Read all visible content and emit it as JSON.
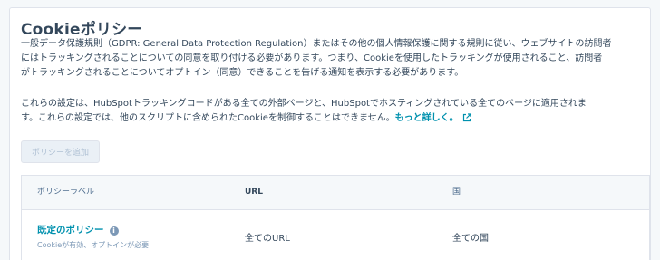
{
  "section": {
    "title": "Cookieポリシー",
    "paragraph1_lines": [
      "一般データ保護規則（GDPR: General Data Protection Regulation）またはその他の個人情報保護に関する規則に従い、ウェブサイトの訪問者",
      "にはトラッキングされることについての同意を取り付ける必要があります。つまり、Cookieを使用したトラッキングが使用されること、訪問者",
      "がトラッキングされることについてオプトイン（同意）できることを告げる通知を表示する必要があります。"
    ],
    "paragraph2_line1": "これらの設定は、HubSpotトラッキングコードがある全ての外部ページと、HubSpotでホスティングされている全てのページに適用されま",
    "paragraph2_line2": "す。これらの設定では、他のスクリプトに含められたCookieを制御することはできません。",
    "learn_more_link": "もっと詳しく。",
    "learn_more_icon": "external-link-icon"
  },
  "add_policy_button": {
    "label": "ポリシーを追加",
    "state": "disabled"
  },
  "policy_table": {
    "columns": [
      "ポリシーラベル",
      "URL",
      "国"
    ],
    "rows": [
      {
        "name": "既定のポリシー",
        "info_icon": "info-icon",
        "description": "Cookieが有効、オプトインが必要",
        "url": "全てのURL",
        "country": "全ての国"
      }
    ]
  },
  "colors": {
    "link": "#0091ae",
    "text": "#33475b",
    "muted": "#7c98b6",
    "border": "#dfe3eb",
    "header_bg": "#f5f8fa"
  }
}
